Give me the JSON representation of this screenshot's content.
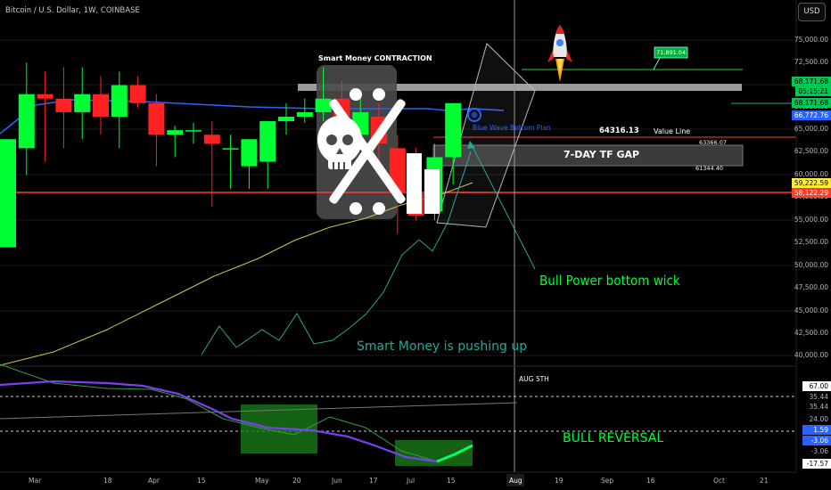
{
  "header": {
    "symbol": "Bitcoin / U.S. Dollar, 1W, COINBASE",
    "currency": "USD"
  },
  "price_axis": [
    "75,000.00",
    "72,500.00",
    "70,000.00",
    "67,500.00",
    "65,000.00",
    "62,500.00",
    "60,000.00",
    "57,500.00",
    "55,000.00",
    "52,500.00",
    "50,000.00",
    "47,500.00",
    "45,000.00",
    "42,500.00",
    "40,000.00"
  ],
  "price_badges": {
    "b1": "68,171.68",
    "b2": "05:15:21",
    "b3": "68,171.68",
    "b4": "66,772.76",
    "b5": "59,222.59",
    "b6": "58,122.29"
  },
  "indicator_axis": [
    "67.00",
    "35.44",
    "35.44",
    "24.00",
    "1.59",
    "-3.06",
    "-3.06",
    "-17.57"
  ],
  "date_axis": [
    "Mar",
    "18",
    "Apr",
    "15",
    "May",
    "20",
    "Jun",
    "17",
    "Jul",
    "15",
    "Aug",
    "19",
    "Sep",
    "16",
    "Oct",
    "21"
  ],
  "annotations": {
    "smart_money_contraction": "Smart Money CONTRACTION",
    "rocket_label": "71,891.04",
    "level_64316": "64316.13",
    "value_line": "Value Line",
    "level_63366": "63366.07",
    "tf_gap": "7-DAY TF GAP",
    "level_61344": "61344.40",
    "blue_text": "Blue Wave Bottom Plan",
    "bull_power": "Bull Power bottom wick",
    "smart_money_pushing": "Smart Money is pushing up",
    "aug_5th": "AUG 5TH",
    "bull_reversal": "BULL REVERSAL"
  },
  "colors": {
    "bull": "#00ff33",
    "bear": "#ff2222",
    "ma": "#2962ff",
    "red_line": "#ff3b30",
    "yellow_ma": "#c8c84a",
    "teal": "#26a69a",
    "purple": "#7b3ff2"
  },
  "chart_data": {
    "type": "candlestick",
    "symbol": "BTCUSD",
    "interval": "1W",
    "y_range": [
      40000,
      75000
    ],
    "horizontal_levels": [
      64316.13,
      63366.07,
      61344.4,
      58122.29
    ],
    "candles": [
      {
        "o": 52000,
        "h": 64000,
        "l": 52000,
        "c": 64000
      },
      {
        "o": 63000,
        "h": 72500,
        "l": 60000,
        "c": 69000
      },
      {
        "o": 69000,
        "h": 71500,
        "l": 61500,
        "c": 68500
      },
      {
        "o": 68500,
        "h": 72000,
        "l": 63000,
        "c": 67000
      },
      {
        "o": 67000,
        "h": 72000,
        "l": 64000,
        "c": 69000
      },
      {
        "o": 69000,
        "h": 71000,
        "l": 64500,
        "c": 66500
      },
      {
        "o": 66500,
        "h": 71500,
        "l": 63000,
        "c": 70000
      },
      {
        "o": 70000,
        "h": 71000,
        "l": 67500,
        "c": 68000
      },
      {
        "o": 68000,
        "h": 69000,
        "l": 61000,
        "c": 64500
      },
      {
        "o": 64500,
        "h": 65500,
        "l": 62000,
        "c": 65000
      },
      {
        "o": 65000,
        "h": 65800,
        "l": 63500,
        "c": 65000
      },
      {
        "o": 64500,
        "h": 66000,
        "l": 56500,
        "c": 63500
      },
      {
        "o": 63000,
        "h": 64500,
        "l": 58500,
        "c": 63000
      },
      {
        "o": 61000,
        "h": 64000,
        "l": 58500,
        "c": 64000
      },
      {
        "o": 61500,
        "h": 65500,
        "l": 58500,
        "c": 66000
      },
      {
        "o": 66000,
        "h": 68000,
        "l": 64500,
        "c": 66500
      },
      {
        "o": 66500,
        "h": 68500,
        "l": 65800,
        "c": 67000
      },
      {
        "o": 67000,
        "h": 72000,
        "l": 66000,
        "c": 68500
      },
      {
        "o": 68500,
        "h": 70500,
        "l": 66500,
        "c": 64500
      },
      {
        "o": 64500,
        "h": 69000,
        "l": 64000,
        "c": 67000
      },
      {
        "o": 66500,
        "h": 68000,
        "l": 60500,
        "c": 63500
      },
      {
        "o": 63000,
        "h": 64500,
        "l": 53500,
        "c": 58000
      },
      {
        "o": 58000,
        "h": 63000,
        "l": 55000,
        "c": 55500
      },
      {
        "o": 56000,
        "h": 63500,
        "l": 55000,
        "c": 62000
      },
      {
        "o": 62000,
        "h": 68000,
        "l": 59000,
        "c": 68000
      }
    ]
  }
}
